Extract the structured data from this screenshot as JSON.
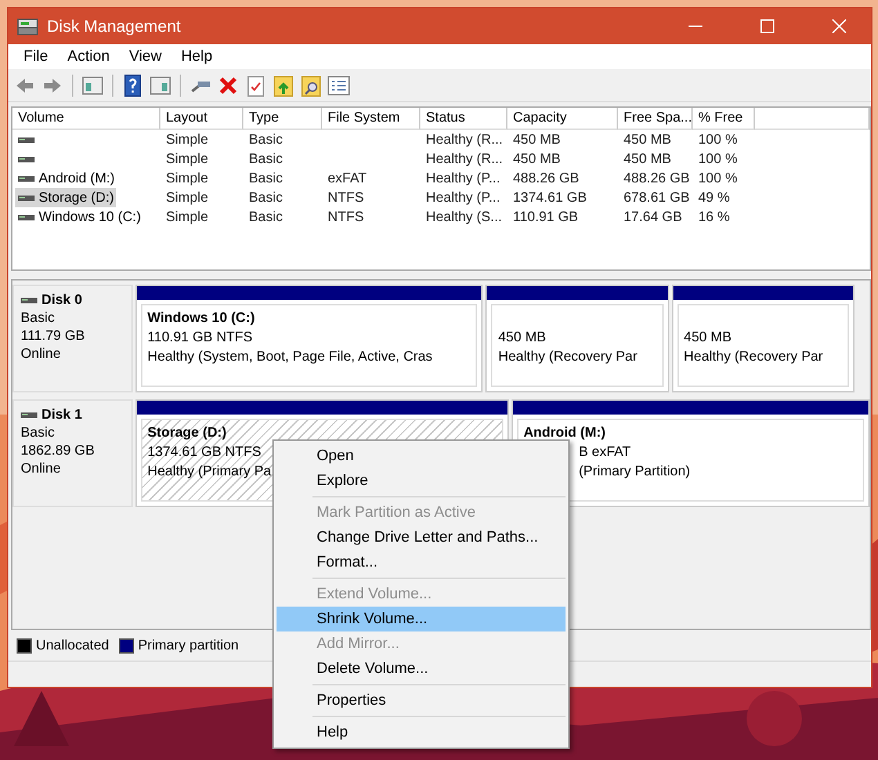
{
  "window": {
    "title": "Disk Management"
  },
  "menu_bar": [
    "File",
    "Action",
    "View",
    "Help"
  ],
  "toolbar": [
    {
      "kind": "back"
    },
    {
      "kind": "forward"
    },
    {
      "kind": "separator"
    },
    {
      "kind": "tree"
    },
    {
      "kind": "separator"
    },
    {
      "kind": "help"
    },
    {
      "kind": "panel"
    },
    {
      "kind": "separator"
    },
    {
      "kind": "connect"
    },
    {
      "kind": "delete"
    },
    {
      "kind": "check"
    },
    {
      "kind": "folder-up"
    },
    {
      "kind": "folder-search"
    },
    {
      "kind": "list"
    }
  ],
  "table": {
    "columns": [
      "Volume",
      "Layout",
      "Type",
      "File System",
      "Status",
      "Capacity",
      "Free Spa...",
      "% Free"
    ],
    "rows": [
      {
        "selected": false,
        "cells": [
          "",
          "Simple",
          "Basic",
          "",
          "Healthy (R...",
          "450 MB",
          "450 MB",
          "100 %"
        ]
      },
      {
        "selected": false,
        "cells": [
          "",
          "Simple",
          "Basic",
          "",
          "Healthy (R...",
          "450 MB",
          "450 MB",
          "100 %"
        ]
      },
      {
        "selected": false,
        "cells": [
          "Android (M:)",
          "Simple",
          "Basic",
          "exFAT",
          "Healthy (P...",
          "488.26 GB",
          "488.26 GB",
          "100 %"
        ]
      },
      {
        "selected": true,
        "cells": [
          "Storage (D:)",
          "Simple",
          "Basic",
          "NTFS",
          "Healthy (P...",
          "1374.61 GB",
          "678.61 GB",
          "49 %"
        ]
      },
      {
        "selected": false,
        "cells": [
          "Windows 10 (C:)",
          "Simple",
          "Basic",
          "NTFS",
          "Healthy (S...",
          "110.91 GB",
          "17.64 GB",
          "16 %"
        ]
      }
    ]
  },
  "disks": [
    {
      "name": "Disk 0",
      "type": "Basic",
      "size": "111.79 GB",
      "state": "Online",
      "partitions": [
        {
          "title": "Windows 10  (C:)",
          "size": "110.91 GB NTFS",
          "status": "Healthy (System, Boot, Page File, Active, Cras",
          "selected": false
        },
        {
          "size": "450 MB",
          "status": "Healthy (Recovery Par",
          "selected": false
        },
        {
          "size": "450 MB",
          "status": "Healthy (Recovery Par",
          "selected": false
        }
      ]
    },
    {
      "name": "Disk 1",
      "type": "Basic",
      "size": "1862.89 GB",
      "state": "Online",
      "partitions": [
        {
          "title": "Storage  (D:)",
          "size": "1374.61 GB NTFS",
          "status": "Healthy (Primary Pa",
          "selected": true
        },
        {
          "title": "Android  (M:)",
          "size": "B exFAT",
          "status": "(Primary Partition)",
          "selected": false
        }
      ]
    }
  ],
  "legend": [
    {
      "label": "Unallocated",
      "color": "#000000"
    },
    {
      "label": "Primary partition",
      "color": "#000080"
    }
  ],
  "context_menu": [
    {
      "kind": "item",
      "label": "Open",
      "disabled": false,
      "selected": false
    },
    {
      "kind": "item",
      "label": "Explore",
      "disabled": false,
      "selected": false
    },
    {
      "kind": "separator"
    },
    {
      "kind": "item",
      "label": "Mark Partition as Active",
      "disabled": true,
      "selected": false
    },
    {
      "kind": "item",
      "label": "Change Drive Letter and Paths...",
      "disabled": false,
      "selected": false
    },
    {
      "kind": "item",
      "label": "Format...",
      "disabled": false,
      "selected": false
    },
    {
      "kind": "separator"
    },
    {
      "kind": "item",
      "label": "Extend Volume...",
      "disabled": true,
      "selected": false
    },
    {
      "kind": "item",
      "label": "Shrink Volume...",
      "disabled": false,
      "selected": true
    },
    {
      "kind": "item",
      "label": "Add Mirror...",
      "disabled": true,
      "selected": false
    },
    {
      "kind": "item",
      "label": "Delete Volume...",
      "disabled": false,
      "selected": false
    },
    {
      "kind": "separator"
    },
    {
      "kind": "item",
      "label": "Properties",
      "disabled": false,
      "selected": false
    },
    {
      "kind": "separator"
    },
    {
      "kind": "item",
      "label": "Help",
      "disabled": false,
      "selected": false
    }
  ]
}
